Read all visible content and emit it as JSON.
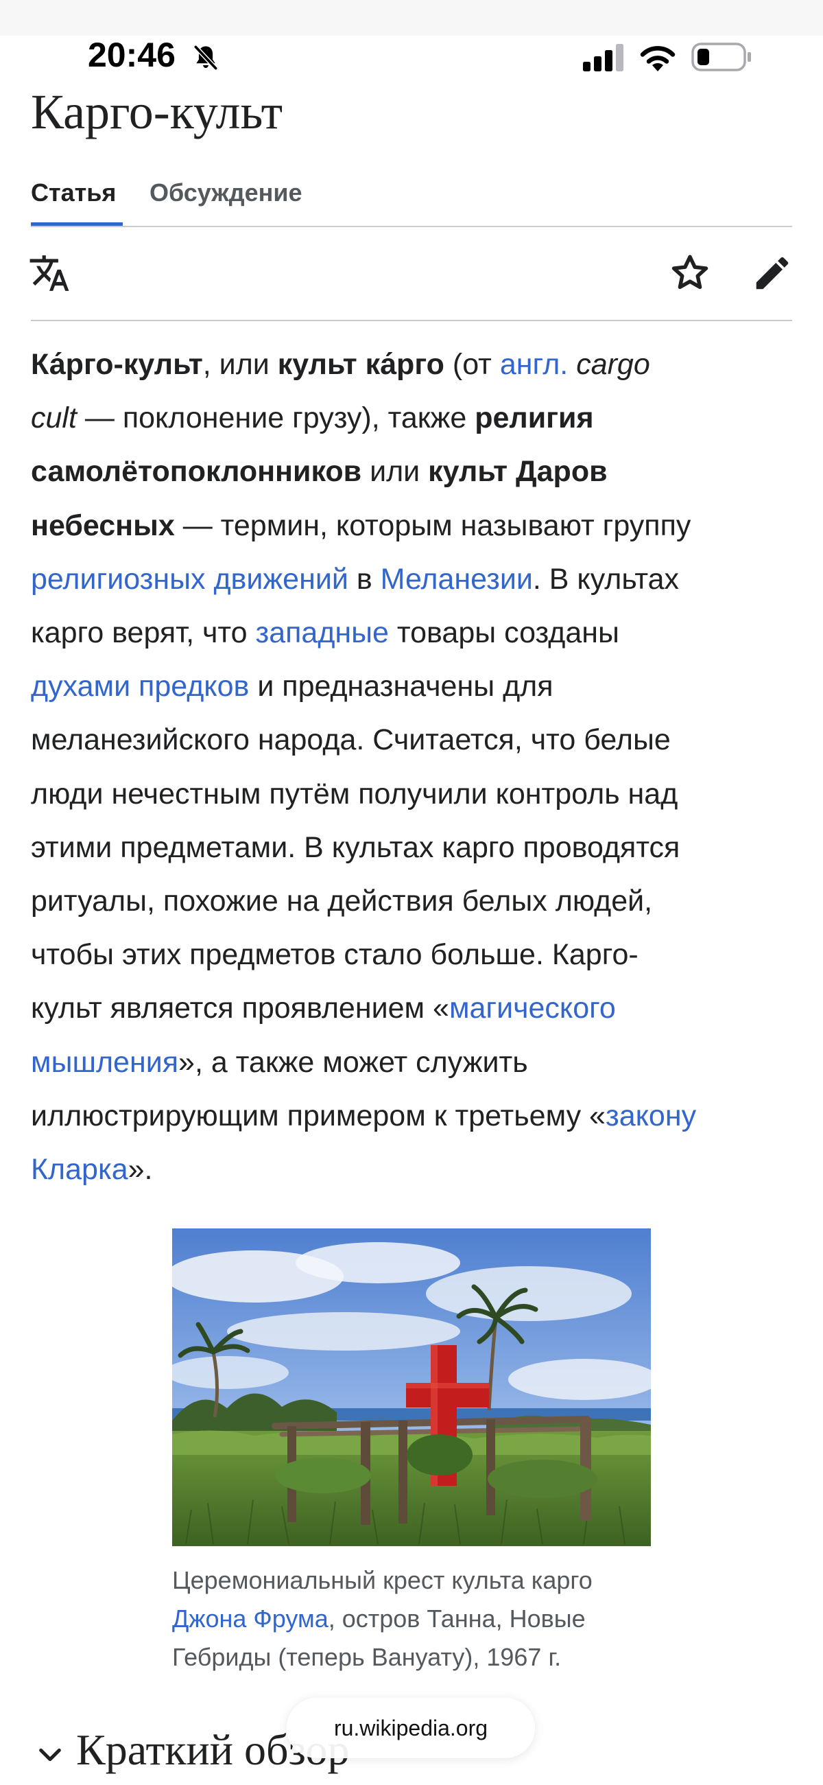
{
  "status_bar": {
    "time": "20:46",
    "icons": [
      "bell-slash-icon",
      "cellular-signal-icon",
      "wifi-icon",
      "battery-icon"
    ]
  },
  "article": {
    "title": "Карго-культ",
    "tabs": [
      {
        "label": "Статья",
        "active": true
      },
      {
        "label": "Обсуждение",
        "active": false
      }
    ],
    "actions": [
      "language-icon",
      "watch-star-icon",
      "edit-pencil-icon"
    ],
    "lead": {
      "line1": {
        "b1": "Ка́рго-культ",
        "t1": ", или ",
        "b2": "культ ка́рго",
        "t2": " (от ",
        "l1": "англ.",
        "i1": " cargo"
      },
      "line2": {
        "i1": "cult",
        "t1": " — поклонение грузу), также ",
        "b1": "религия"
      },
      "line3": {
        "b1": "самолётопоклонников",
        "t1": " или ",
        "b2": "культ Даров"
      },
      "line4": {
        "b1": "небесных",
        "t1": " — термин, которым называют группу"
      },
      "line5": {
        "l1": "религиозных движений",
        "t1": " в ",
        "l2": "Меланезии",
        "t2": ". В культах"
      },
      "line6": {
        "t1": "карго верят, что ",
        "l1": "западные",
        "t2": " товары созданы"
      },
      "line7": {
        "l1": "духами предков",
        "t1": " и предназначены для"
      },
      "line8": "меланезийского народа. Считается, что белые",
      "line9": "люди нечестным путём получили контроль над",
      "line10": "этими предметами. В культах карго проводятся",
      "line11": "ритуалы, похожие на действия белых людей,",
      "line12": "чтобы этих предметов стало больше. Карго-",
      "line13": {
        "t1": "культ является проявлением «",
        "l1": "магического"
      },
      "line14": {
        "l1": "мышления",
        "t1": "», а также может служить"
      },
      "line15": {
        "t1": "иллюстрирующим примером к третьему «",
        "l1": "закону"
      },
      "line16": {
        "l1": "Кларка",
        "t1": "»."
      }
    },
    "figure": {
      "caption": {
        "line1": "Церемониальный крест культа карго",
        "link": "Джона Фрума",
        "line2_rest": ", остров Танна, Новые",
        "line3": "Гебриды (теперь Вануату), 1967 г."
      }
    },
    "section": {
      "title": "Краткий обзор"
    }
  },
  "browser": {
    "url": "ru.wikipedia.org"
  },
  "colors": {
    "link": "#3366cc",
    "text": "#202122",
    "secondary_text": "#54595d",
    "divider": "#c8ccd1",
    "cross_red": "#c41d1d"
  }
}
